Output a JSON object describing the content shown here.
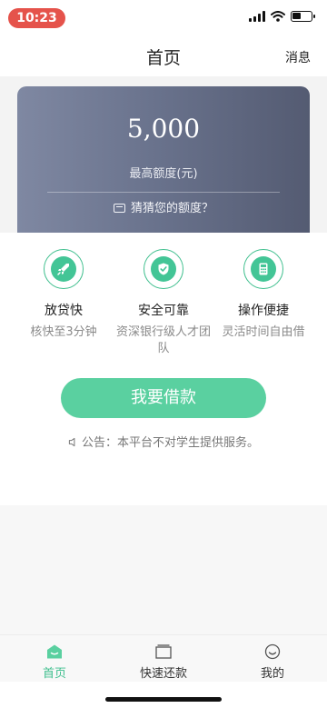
{
  "status_bar": {
    "time": "10:23",
    "battery_level": 0.45
  },
  "header": {
    "title": "首页",
    "message_label": "消息"
  },
  "card": {
    "amount": "5,000",
    "subtitle": "最高额度(元)",
    "guess_label": "猜猜您的额度？",
    "guess_icon": "card-icon"
  },
  "features": [
    {
      "icon": "rocket-icon",
      "title": "放贷快",
      "desc": "核快至3分钟"
    },
    {
      "icon": "shield-check-icon",
      "title": "安全可靠",
      "desc": "资深银行级人才团队"
    },
    {
      "icon": "calculator-icon",
      "title": "操作便捷",
      "desc": "灵活时间自由借"
    }
  ],
  "borrow_button": "我要借款",
  "notice": {
    "icon": "speaker-icon",
    "text": "公告：本平台不对学生提供服务。"
  },
  "tabs": [
    {
      "label": "首页",
      "icon": "home-icon",
      "active": true
    },
    {
      "label": "快速还款",
      "icon": "wallet-icon",
      "active": false
    },
    {
      "label": "我的",
      "icon": "smile-face-icon",
      "active": false
    }
  ],
  "colors": {
    "accent": "#43c596",
    "card_start": "#7f88a2",
    "card_end": "#545b72",
    "time_pill": "#e5534b"
  }
}
